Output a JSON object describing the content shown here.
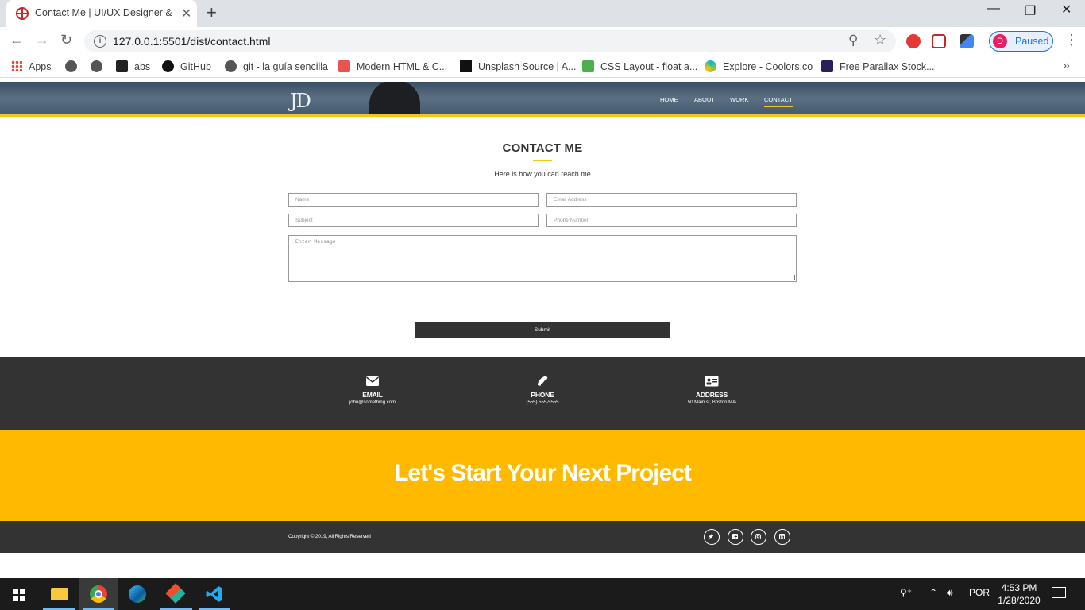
{
  "browser": {
    "tab_title": "Contact Me | UI/UX Designer & F",
    "tab_close": "✕",
    "new_tab": "+",
    "url": "127.0.0.1:5501/dist/contact.html",
    "profile_initial": "D",
    "profile_status": "Paused",
    "bookmarks": [
      {
        "label": "Apps"
      },
      {
        "label": ""
      },
      {
        "label": ""
      },
      {
        "label": "abs"
      },
      {
        "label": "GitHub"
      },
      {
        "label": "git - la guía sencilla"
      },
      {
        "label": "Modern HTML & C..."
      },
      {
        "label": "Unsplash Source | A..."
      },
      {
        "label": "CSS Layout - float a..."
      },
      {
        "label": "Explore - Coolors.co"
      },
      {
        "label": "Free Parallax Stock..."
      }
    ]
  },
  "site": {
    "logo": "JD",
    "nav": [
      {
        "label": "Home"
      },
      {
        "label": "About"
      },
      {
        "label": "Work"
      },
      {
        "label": "Contact",
        "active": true
      }
    ],
    "contact": {
      "title": "CONTACT ME",
      "subtitle": "Here is how you can reach me",
      "fields": {
        "name": "Name",
        "email": "Email Address",
        "subject": "Subject",
        "phone": "Phone Number",
        "message": "Enter Message"
      },
      "submit_label": "Submit"
    },
    "info": [
      {
        "label": "EMAIL",
        "value": "john@something.com",
        "icon": "envelope-icon"
      },
      {
        "label": "PHONE",
        "value": "(555) 555-5555",
        "icon": "phone-icon"
      },
      {
        "label": "ADDRESS",
        "value": "50 Main st, Boston MA",
        "icon": "address-card-icon"
      }
    ],
    "cta": "Let's Start Your Next Project",
    "copyright": "Copyright © 2019, All Rights Reserved",
    "social": [
      "twitter-icon",
      "facebook-icon",
      "instagram-icon",
      "linkedin-icon"
    ]
  },
  "taskbar": {
    "language": "POR",
    "time": "4:53 PM",
    "date": "1/28/2020"
  },
  "colors": {
    "accent": "#ffba00",
    "dark": "#333333",
    "nav_underline": "#f5c518"
  }
}
